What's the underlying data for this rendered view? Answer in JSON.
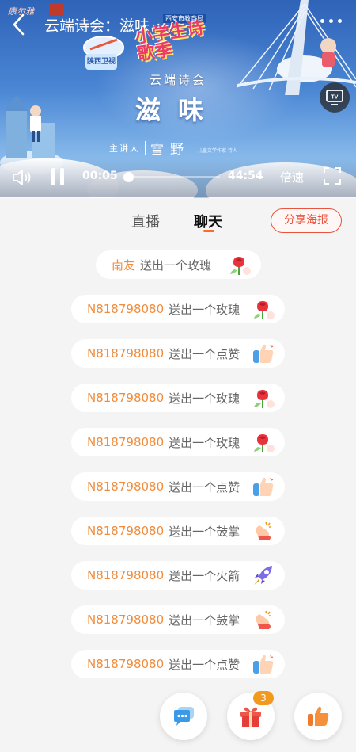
{
  "app": {
    "brand_logo": "康尔雅",
    "title": "云端诗会：滋味"
  },
  "video": {
    "show_logo_top": "西安市教育局",
    "show_logo_text": "小学生诗歌季",
    "badge_small": "陕西卫视",
    "series_title": "云端诗会",
    "episode_title": "滋味",
    "speaker_role": "主讲人",
    "speaker_name": "雪野",
    "speaker_note": "儿童文学作家 诗人",
    "current_time": "00:05",
    "total_time": "44:54",
    "progress_fraction": 0.002,
    "speed_label": "倍速",
    "icons": [
      "back-icon",
      "more-icon",
      "tv-icon",
      "volume-icon",
      "pause-icon",
      "fullscreen-icon"
    ]
  },
  "tabs": {
    "live_label": "直播",
    "chat_label": "聊天",
    "active": "chat",
    "share_label": "分享海报"
  },
  "chat": {
    "messages": [
      {
        "user": "南友",
        "text": "送出一个玫瑰",
        "gift": "rose"
      },
      {
        "user": "N818798080",
        "text": "送出一个玫瑰",
        "gift": "rose"
      },
      {
        "user": "N818798080",
        "text": "送出一个点赞",
        "gift": "thumbs-up"
      },
      {
        "user": "N818798080",
        "text": "送出一个玫瑰",
        "gift": "rose"
      },
      {
        "user": "N818798080",
        "text": "送出一个玫瑰",
        "gift": "rose"
      },
      {
        "user": "N818798080",
        "text": "送出一个点赞",
        "gift": "thumbs-up"
      },
      {
        "user": "N818798080",
        "text": "送出一个鼓掌",
        "gift": "clap"
      },
      {
        "user": "N818798080",
        "text": "送出一个火箭",
        "gift": "rocket"
      },
      {
        "user": "N818798080",
        "text": "送出一个鼓掌",
        "gift": "clap"
      },
      {
        "user": "N818798080",
        "text": "送出一个点赞",
        "gift": "thumbs-up"
      }
    ]
  },
  "actions": {
    "gift_badge_count": "3",
    "icons": [
      "chat-bubble-icon",
      "gift-box-icon",
      "thumbs-up-icon"
    ]
  },
  "colors": {
    "accent": "#ff6a2a",
    "username": "#f08c3c",
    "share_border": "#e8553f",
    "badge": "#f29a1f"
  }
}
